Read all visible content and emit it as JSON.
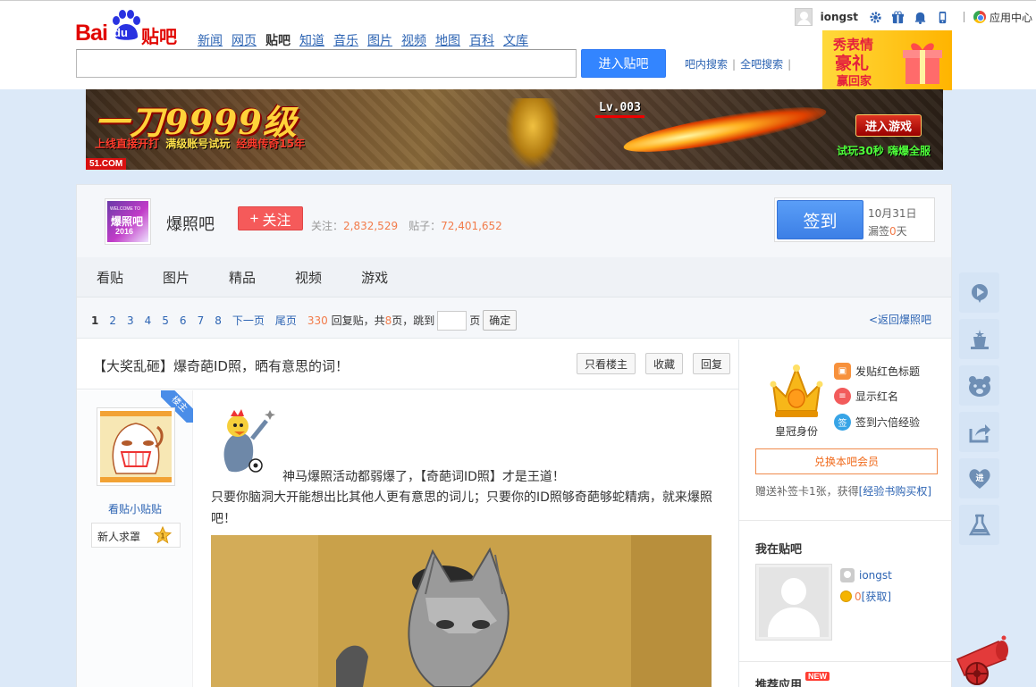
{
  "header": {
    "logo_text": "Bai",
    "logo_du": "du",
    "logo_tieba": "贴吧",
    "nav": [
      {
        "label": "新闻",
        "active": false
      },
      {
        "label": "网页",
        "active": false
      },
      {
        "label": "贴吧",
        "active": true
      },
      {
        "label": "知道",
        "active": false
      },
      {
        "label": "音乐",
        "active": false
      },
      {
        "label": "图片",
        "active": false
      },
      {
        "label": "视频",
        "active": false
      },
      {
        "label": "地图",
        "active": false
      },
      {
        "label": "百科",
        "active": false
      },
      {
        "label": "文库",
        "active": false
      }
    ],
    "search_value": "",
    "search_button": "进入贴吧",
    "scope_in_forum": "吧内搜索",
    "scope_all": "全吧搜索",
    "scope_sep": "|",
    "promo": {
      "line1": "秀表情",
      "line2": "豪礼",
      "line3": "赢回家"
    }
  },
  "userbar": {
    "username": "iongst",
    "icons": [
      "gear-icon",
      "gift-icon",
      "bell-icon",
      "phone-icon"
    ],
    "app_center": "应用中心"
  },
  "ad": {
    "headline": "一刀9999级",
    "sub_a": "上线直接开打",
    "sub_b": "满级账号试玩",
    "sub_c": "经典传奇15年",
    "level": "Lv.003",
    "enter": "进入游戏",
    "try": "试玩30秒 嗨爆全服",
    "brand": "51.COM"
  },
  "forum": {
    "name": "爆照吧",
    "avatar_welcome": "WELCOME TO",
    "avatar_title": "爆照吧",
    "avatar_year": "2016",
    "follow": "关注",
    "follow_plus": "+",
    "followers_label": "关注：",
    "followers": "2,832,529",
    "posts_label": "贴子：",
    "posts": "72,401,652",
    "sign": "签到",
    "sign_date": "10月31日",
    "missed_prefix": "漏签",
    "missed_days": "0",
    "missed_suffix": "天"
  },
  "tabs": [
    "看贴",
    "图片",
    "精品",
    "视频",
    "游戏"
  ],
  "pager": {
    "pages": [
      "1",
      "2",
      "3",
      "4",
      "5",
      "6",
      "7",
      "8"
    ],
    "current": "1",
    "next": "下一页",
    "last": "尾页",
    "reply_count": "330",
    "reply_label": "回复贴，共",
    "page_count": "8",
    "page_label": "页，跳到",
    "page_unit": "页",
    "confirm": "确定",
    "back": "<返回爆照吧"
  },
  "thread": {
    "title": "【大奖乱砸】爆奇葩ID照，晒有意思的词！",
    "only_op": "只看楼主",
    "favorite": "收藏",
    "reply": "回复"
  },
  "post": {
    "op_badge": "楼主",
    "author": "看贴小贴贴",
    "level_label": "新人求罩",
    "level_num": "1",
    "line1": "神马爆照活动都弱爆了，【奇葩词ID照】才是王道！",
    "line2": "只要你脑洞大开能想出比其他人更有意思的词儿；只要你的ID照够奇葩够蛇精病，就来爆照吧！"
  },
  "sidebar": {
    "crown_label": "皇冠身份",
    "perks": [
      {
        "icon": "bookmark-icon",
        "glyph": "▣",
        "label": "发贴红色标题"
      },
      {
        "icon": "chat-icon",
        "glyph": "≡",
        "label": "显示红名"
      },
      {
        "icon": "sign-icon",
        "glyph": "签",
        "label": "签到六倍经验"
      }
    ],
    "exchange": "兑换本吧会员",
    "note_prefix": "赠送补签卡1张，获得",
    "note_link": "[经验书购买权]",
    "mine_title": "我在贴吧",
    "mine_name": "iongst",
    "mine_coins": "0",
    "mine_get": "[获取]",
    "rec_title": "推荐应用",
    "new_badge": "NEW"
  },
  "float_tools": [
    {
      "name": "play-icon"
    },
    {
      "name": "magic-hat-icon"
    },
    {
      "name": "bear-icon"
    },
    {
      "name": "share-icon"
    },
    {
      "name": "heart-icon",
      "text": "进"
    },
    {
      "name": "flask-icon"
    }
  ],
  "colors": {
    "accent": "#3385ff",
    "link": "#2d64b3",
    "brand_red": "#e10601",
    "follow_red": "#f55a5a",
    "stat_orange": "#f27b4a",
    "page_bg": "#dce9f8"
  }
}
